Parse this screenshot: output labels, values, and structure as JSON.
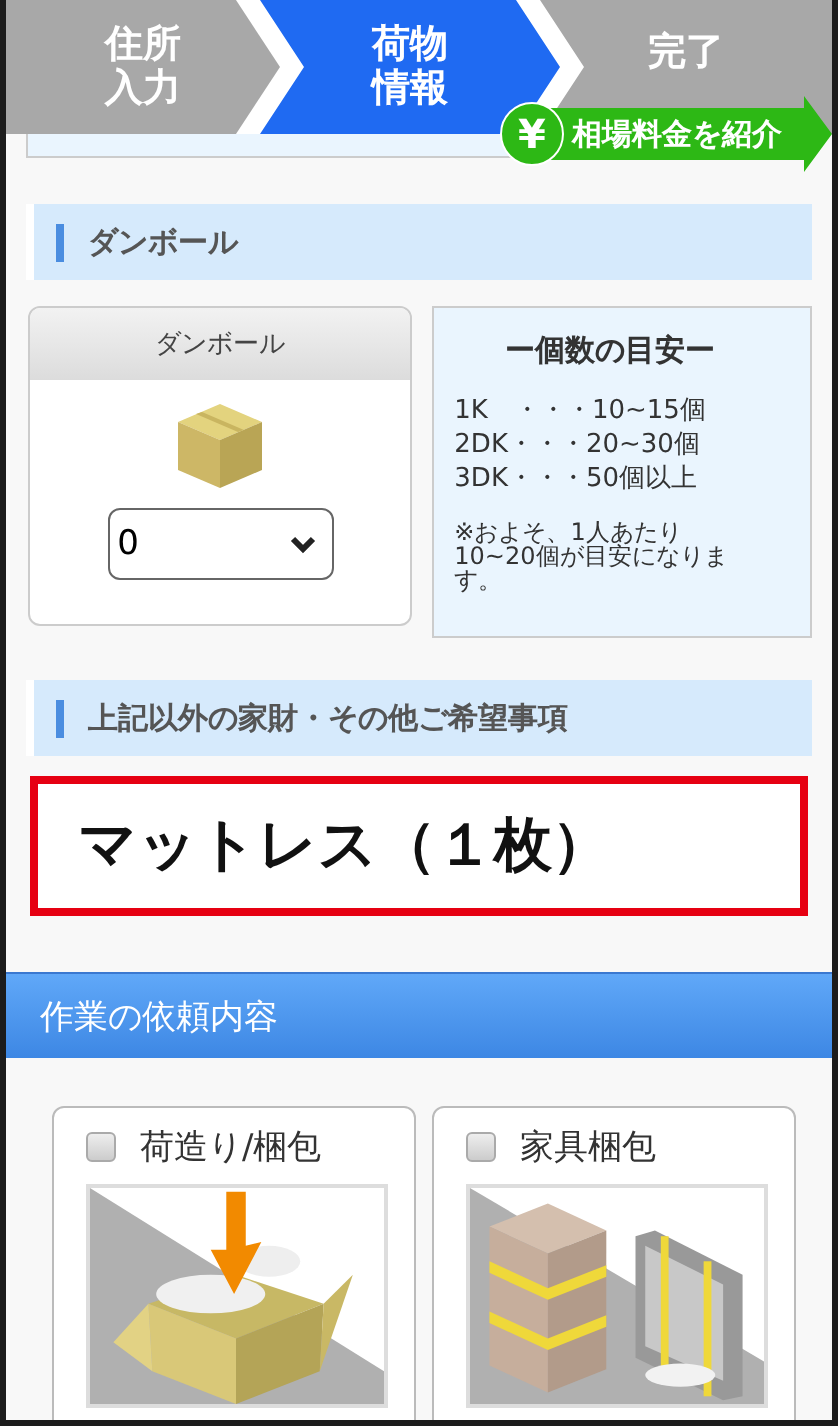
{
  "steps": [
    {
      "label": "住所入力",
      "selected": false
    },
    {
      "label": "荷物情報",
      "selected": true
    },
    {
      "label": "完了",
      "selected": false
    }
  ],
  "price_badge": {
    "icon": "¥",
    "label": "相場料金を紹介"
  },
  "cardboard_section": {
    "heading": "ダンボール",
    "item": {
      "name": "ダンボール",
      "quantity": "0"
    },
    "guide": {
      "title": "ー個数の目安ー",
      "lines": [
        "1K　・・・10~15個",
        "2DK・・・20~30個",
        "3DK・・・50個以上"
      ],
      "note": "※およそ、1人あたり\n10~20個が目安になります。"
    }
  },
  "other_section": {
    "heading": "上記以外の家財・その他ご希望事項",
    "entry": "マットレス（１枚）"
  },
  "work_section": {
    "heading": "作業の依頼内容",
    "options": [
      {
        "label": "荷造り/梱包",
        "checked": false,
        "kind": "packing"
      },
      {
        "label": "家具梱包",
        "checked": false,
        "kind": "furniture"
      }
    ]
  }
}
